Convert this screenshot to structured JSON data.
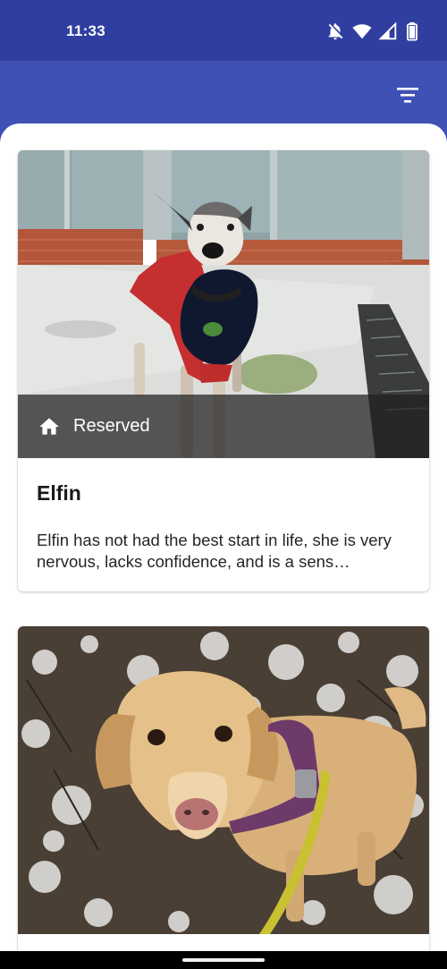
{
  "status_bar": {
    "time": "11:33",
    "icons": [
      "bell-off-icon",
      "wifi-icon",
      "signal-icon",
      "battery-icon"
    ]
  },
  "app_bar": {
    "action_icon": "filter-icon",
    "colors": {
      "status": "#303f9f",
      "bar": "#3f51b5"
    }
  },
  "pets": [
    {
      "name": "Elfin",
      "status": "Reserved",
      "status_icon": "home-icon",
      "description": "Elfin has not had the best start in life, she is very nervous, lacks confidence, and is a sens…"
    },
    {
      "photo": "golden-dog-photo"
    }
  ]
}
